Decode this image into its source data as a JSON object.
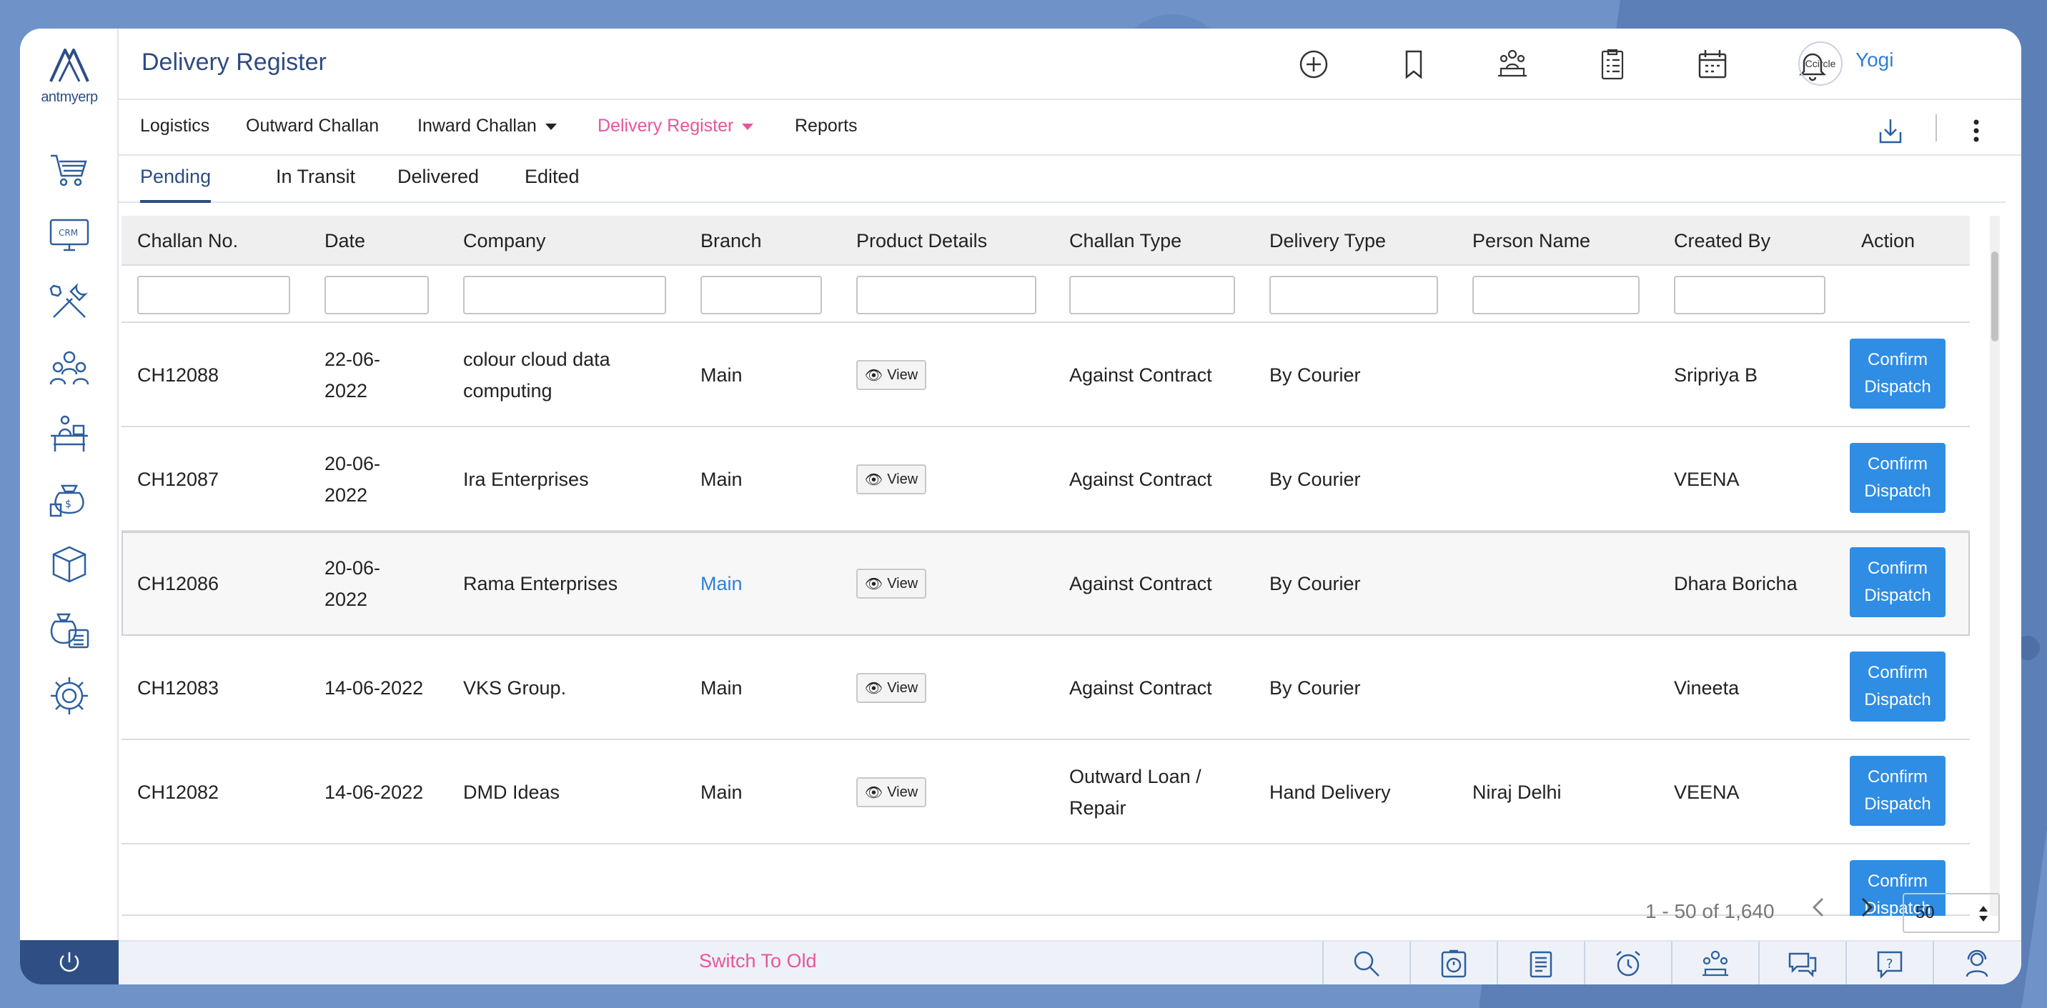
{
  "app": {
    "title": "Delivery Register",
    "user": "Yogi",
    "avatar_text": "Ccircle",
    "logo_text": "antmyerp"
  },
  "colors": {
    "accent": "#2d4b82",
    "link": "#2f7fd6",
    "active_menu": "#e8559b",
    "button": "#2f8de4"
  },
  "sidebar": {
    "items": [
      {
        "icon": "cart-icon"
      },
      {
        "icon": "crm-icon"
      },
      {
        "icon": "tools-icon"
      },
      {
        "icon": "team-icon"
      },
      {
        "icon": "desk-icon"
      },
      {
        "icon": "finance-icon"
      },
      {
        "icon": "box-icon"
      },
      {
        "icon": "accounting-icon"
      },
      {
        "icon": "settings-icon"
      }
    ]
  },
  "topbar": {
    "icons": [
      "add-icon",
      "bookmark-icon",
      "meeting-icon",
      "checklist-icon",
      "calendar-icon",
      "bell-icon"
    ]
  },
  "menu": {
    "logistics": "Logistics",
    "outward": "Outward Challan",
    "inward": "Inward Challan",
    "delivery": "Delivery Register",
    "reports": "Reports"
  },
  "tabs": {
    "pending": "Pending",
    "in_transit": "In Transit",
    "delivered": "Delivered",
    "edited": "Edited"
  },
  "table": {
    "headers": {
      "challan": "Challan No.",
      "date": "Date",
      "company": "Company",
      "branch": "Branch",
      "product": "Product Details",
      "ctype": "Challan Type",
      "dtype": "Delivery Type",
      "person": "Person Name",
      "created": "Created By",
      "action": "Action"
    },
    "view_label": "View",
    "action_line1": "Confirm",
    "action_line2": "Dispatch",
    "rows": [
      {
        "challan": "CH12088",
        "date1": "22-06-",
        "date2": "2022",
        "company1": "colour cloud data",
        "company2": "computing",
        "branch": "Main",
        "ctype1": "Against Contract",
        "ctype2": "",
        "dtype": "By Courier",
        "person": "",
        "created": "Sripriya B"
      },
      {
        "challan": "CH12087",
        "date1": "20-06-",
        "date2": "2022",
        "company1": "Ira Enterprises",
        "company2": "",
        "branch": "Main",
        "ctype1": "Against Contract",
        "ctype2": "",
        "dtype": "By Courier",
        "person": "",
        "created": "VEENA"
      },
      {
        "challan": "CH12086",
        "date1": "20-06-",
        "date2": "2022",
        "company1": "Rama Enterprises",
        "company2": "",
        "branch": "Main",
        "ctype1": "Against Contract",
        "ctype2": "",
        "dtype": "By Courier",
        "person": "",
        "created": "Dhara Boricha"
      },
      {
        "challan": "CH12083",
        "date1": "14-06-2022",
        "date2": "",
        "company1": "VKS Group.",
        "company2": "",
        "branch": "Main",
        "ctype1": "Against Contract",
        "ctype2": "",
        "dtype": "By Courier",
        "person": "",
        "created": "Vineeta"
      },
      {
        "challan": "CH12082",
        "date1": "14-06-2022",
        "date2": "",
        "company1": "DMD Ideas",
        "company2": "",
        "branch": "Main",
        "ctype1": "Outward Loan /",
        "ctype2": "Repair",
        "dtype": "Hand Delivery",
        "person": "Niraj Delhi",
        "created": "VEENA"
      }
    ]
  },
  "pagination": {
    "summary": "1 - 50 of 1,640",
    "page_size": "50"
  },
  "footer": {
    "switch_label": "Switch To Old",
    "icons": [
      "search-icon",
      "stopwatch-icon",
      "notes-icon",
      "alarm-icon",
      "users-icon",
      "chat-icon",
      "help-icon",
      "support-icon"
    ]
  }
}
